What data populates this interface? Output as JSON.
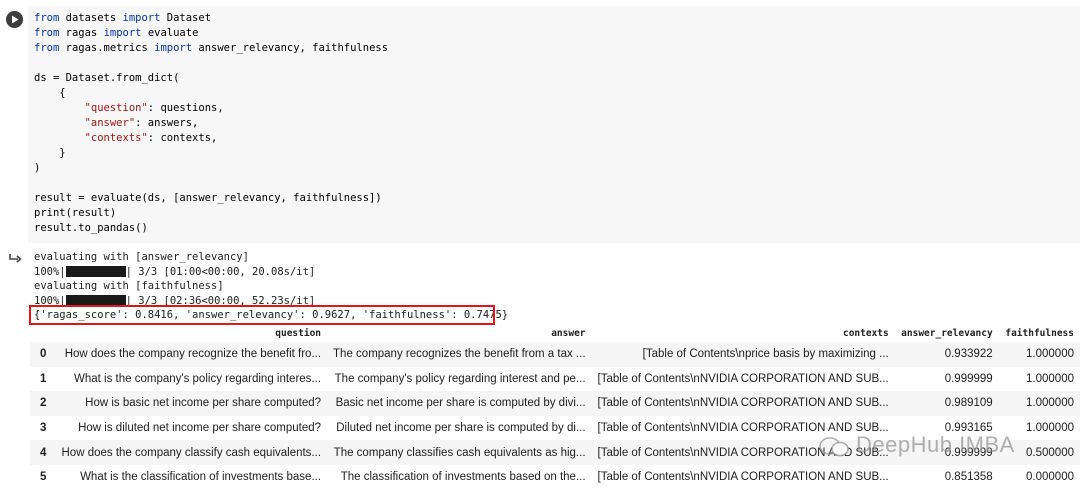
{
  "code_lines": [
    [
      [
        "kw",
        "from"
      ],
      [
        "t",
        " datasets "
      ],
      [
        "kw",
        "import"
      ],
      [
        "t",
        " Dataset"
      ]
    ],
    [
      [
        "kw",
        "from"
      ],
      [
        "t",
        " ragas "
      ],
      [
        "kw",
        "import"
      ],
      [
        "t",
        " evaluate"
      ]
    ],
    [
      [
        "kw",
        "from"
      ],
      [
        "t",
        " ragas.metrics "
      ],
      [
        "kw",
        "import"
      ],
      [
        "t",
        " answer_relevancy, faithfulness"
      ]
    ],
    [],
    [
      [
        "t",
        "ds = Dataset.from_dict("
      ]
    ],
    [
      [
        "t",
        "    {"
      ]
    ],
    [
      [
        "t",
        "        "
      ],
      [
        "str",
        "\"question\""
      ],
      [
        "t",
        ": questions,"
      ]
    ],
    [
      [
        "t",
        "        "
      ],
      [
        "str",
        "\"answer\""
      ],
      [
        "t",
        ": answers,"
      ]
    ],
    [
      [
        "t",
        "        "
      ],
      [
        "str",
        "\"contexts\""
      ],
      [
        "t",
        ": contexts,"
      ]
    ],
    [
      [
        "t",
        "    }"
      ]
    ],
    [
      [
        "t",
        ")"
      ]
    ],
    [],
    [
      [
        "t",
        "result = evaluate(ds, [answer_relevancy, faithfulness])"
      ]
    ],
    [
      [
        "t",
        "print(result)"
      ]
    ],
    [
      [
        "t",
        "result.to_pandas()"
      ]
    ]
  ],
  "output": {
    "line1": "evaluating with [answer_relevancy]",
    "progress1_pct": "100%|",
    "progress1_rest": "| 3/3 [01:00<00:00, 20.08s/it]",
    "line3": "evaluating with [faithfulness]",
    "progress2_pct": "100%|",
    "progress2_rest": "| 3/3 [02:36<00:00, 52.23s/it]",
    "result": "{'ragas_score': 0.8416, 'answer_relevancy': 0.9627, 'faithfulness': 0.7475}"
  },
  "table": {
    "columns": [
      "",
      "question",
      "answer",
      "contexts",
      "answer_relevancy",
      "faithfulness"
    ],
    "rows": [
      [
        "0",
        "How does the company recognize the benefit fro...",
        "The company recognizes the benefit from a tax ...",
        "[Table of Contents\\nprice basis by maximizing ...",
        "0.933922",
        "1.000000"
      ],
      [
        "1",
        "What is the company's policy regarding interes...",
        "The company's policy regarding interest and pe...",
        "[Table of Contents\\nNVIDIA CORPORATION AND SUB...",
        "0.999999",
        "1.000000"
      ],
      [
        "2",
        "How is basic net income per share computed?",
        "Basic net income per share is computed by divi...",
        "[Table of Contents\\nNVIDIA CORPORATION AND SUB...",
        "0.989109",
        "1.000000"
      ],
      [
        "3",
        "How is diluted net income per share computed?",
        "Diluted net income per share is computed by di...",
        "[Table of Contents\\nNVIDIA CORPORATION AND SUB...",
        "0.993165",
        "1.000000"
      ],
      [
        "4",
        "How does the company classify cash equivalents...",
        "The company classifies cash equivalents as hig...",
        "[Table of Contents\\nNVIDIA CORPORATION AND SUB...",
        "0.999999",
        "0.500000"
      ],
      [
        "5",
        "What is the classification of investments base...",
        "The classification of investments based on the...",
        "[Table of Contents\\nNVIDIA CORPORATION AND SUB...",
        "0.851358",
        "0.000000"
      ]
    ]
  },
  "watermark": "DeepHub IMBA",
  "icons": {
    "run": "play-icon",
    "output": "output-arrow-icon",
    "watermark": "wechat-icon"
  }
}
